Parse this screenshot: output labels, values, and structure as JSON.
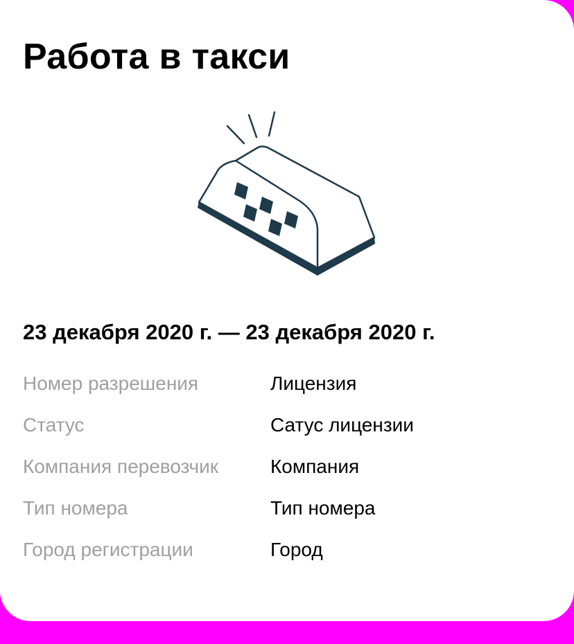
{
  "header": {
    "title": "Работа в такси"
  },
  "illustration": {
    "icon": "taxi-sign-icon",
    "stroke_color": "#1f3a4a"
  },
  "period": {
    "date_range": "23 декабря 2020 г. — 23 декабря 2020 г."
  },
  "details": [
    {
      "label": "Номер разрешения",
      "value": "Лицензия"
    },
    {
      "label": "Статус",
      "value": "Сатус лицензии"
    },
    {
      "label": "Компания перевозчик",
      "value": "Компания"
    },
    {
      "label": "Тип номера",
      "value": "Тип номера"
    },
    {
      "label": "Город регистрации",
      "value": "Город"
    }
  ],
  "colors": {
    "background": "#ff00ff",
    "card": "#ffffff",
    "label": "#a0a0a0",
    "text": "#000000"
  }
}
